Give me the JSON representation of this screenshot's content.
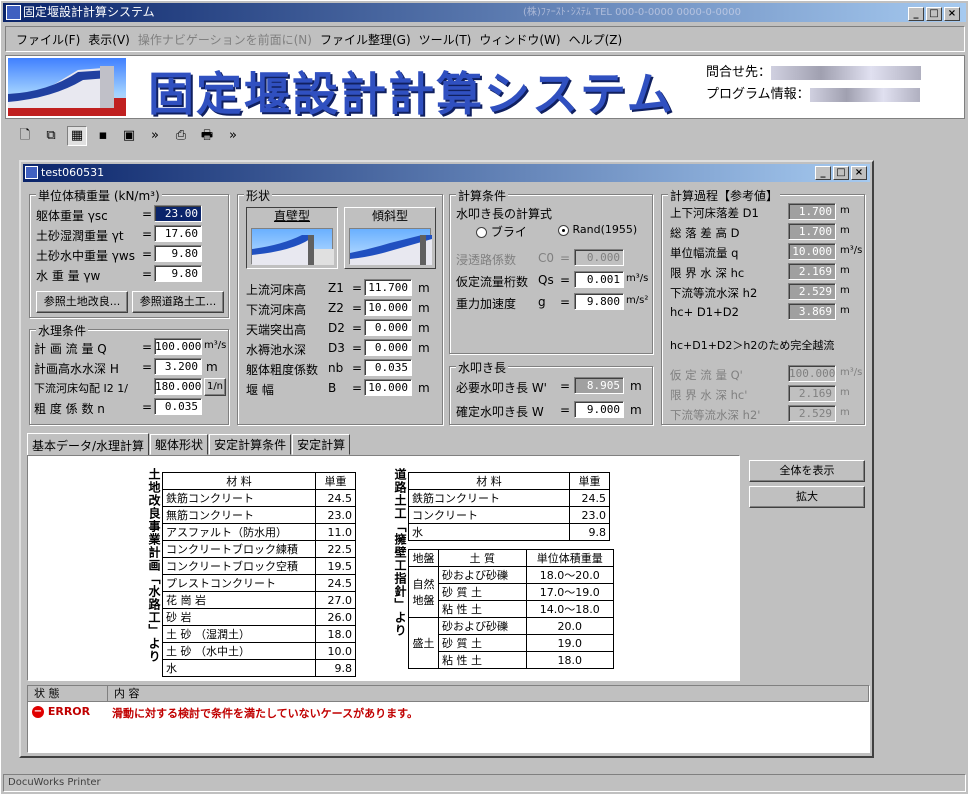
{
  "app": {
    "title": "固定堰設計計算システム",
    "title_extra": "(株)ﾌｧｰｽﾄ･ｼｽﾃﾑ  TEL 000-0-0000  0000-0-0000"
  },
  "menu": [
    "ファイル(F)",
    "表示(V)",
    "操作ナビゲーションを前面に(N)",
    "ファイル整理(G)",
    "ツール(T)",
    "ウィンドウ(W)",
    "ヘルプ(Z)"
  ],
  "banner": {
    "title": "固定堰設計計算システム",
    "contact_label": "問合せ先：",
    "program_label": "プログラム情報："
  },
  "doc": {
    "title": "test060531"
  },
  "unit_weight": {
    "label": "単位体積重量 (kN/m³)",
    "rows": [
      {
        "label": "躯体重量  γsc",
        "value": "23.00"
      },
      {
        "label": "土砂湿潤重量 γt",
        "value": "17.60"
      },
      {
        "label": "土砂水中重量 γws",
        "value": "9.80"
      },
      {
        "label": "水   重   量 γw",
        "value": "9.80"
      }
    ],
    "btn1": "参照土地改良...",
    "btn2": "参照道路土工..."
  },
  "hydro": {
    "label": "水理条件",
    "rows": [
      {
        "label": "計 画 流 量   Q",
        "value": "100.000",
        "unit": "m³/s"
      },
      {
        "label": "計画高水水深  H",
        "value": "3.200",
        "unit": "m"
      },
      {
        "label": "下流河床勾配 I2  1/",
        "value": "180.000",
        "unit": "1/n"
      },
      {
        "label": "粗 度 係 数   n",
        "value": "0.035",
        "unit": ""
      }
    ]
  },
  "shape": {
    "label": "形状",
    "btn_vertical": "直壁型",
    "btn_slope": "傾斜型",
    "rows": [
      {
        "label": "上流河床高",
        "sym": "Z1",
        "value": "11.700",
        "unit": "m"
      },
      {
        "label": "下流河床高",
        "sym": "Z2",
        "value": "10.000",
        "unit": "m"
      },
      {
        "label": "天端突出高",
        "sym": "D2",
        "value": "0.000",
        "unit": "m"
      },
      {
        "label": "水褥池水深",
        "sym": "D3",
        "value": "0.000",
        "unit": "m"
      },
      {
        "label": "躯体粗度係数",
        "sym": "nb",
        "value": "0.035",
        "unit": ""
      },
      {
        "label": "堰     幅",
        "sym": "B",
        "value": "10.000",
        "unit": "m"
      }
    ]
  },
  "calc": {
    "label": "計算条件",
    "formula_label": "水叩き長の計算式",
    "radio1": "ブライ",
    "radio2": "Rand(1955)",
    "rows": [
      {
        "label": "浸透路係数",
        "sym": "C0",
        "value": "0.000",
        "unit": ""
      },
      {
        "label": "仮定流量桁数",
        "sym": "Qs",
        "value": "0.001",
        "unit": "m³/s"
      },
      {
        "label": "重力加速度",
        "sym": "g",
        "value": "9.800",
        "unit": "m/s²"
      }
    ]
  },
  "apron": {
    "label": "水叩き長",
    "rows": [
      {
        "label": "必要水叩き長 W'",
        "value": "8.905",
        "unit": "m"
      },
      {
        "label": "確定水叩き長 W",
        "value": "9.000",
        "unit": "m"
      }
    ]
  },
  "process": {
    "label": "計算過程【参考値】",
    "rows": [
      {
        "label": "上下河床落差 D1",
        "value": "1.700",
        "unit": "m"
      },
      {
        "label": "総 落 差 高  D",
        "value": "1.700",
        "unit": "m"
      },
      {
        "label": "単位幅流量   q",
        "value": "10.000",
        "unit": "m³/s"
      },
      {
        "label": "限 界 水 深  hc",
        "value": "2.169",
        "unit": "m"
      },
      {
        "label": "下流等流水深 h2",
        "value": "2.529",
        "unit": "m"
      },
      {
        "label": "hc+ D1+D2",
        "value": "3.869",
        "unit": "m"
      }
    ],
    "note": "hc+D1+D2＞h2のため完全越流",
    "rows2": [
      {
        "label": "仮 定 流 量  Q'",
        "value": "100.000",
        "unit": "m³/s"
      },
      {
        "label": "限 界 水 深  hc'",
        "value": "2.169",
        "unit": "m"
      },
      {
        "label": "下流等流水深 h2'",
        "value": "2.529",
        "unit": "m"
      }
    ]
  },
  "tabs": [
    "基本データ/水理計算",
    "躯体形状",
    "安定計算条件",
    "安定計算"
  ],
  "side_buttons": [
    "全体を表示",
    "拡大"
  ],
  "table1": {
    "vlabel": "土地改良事業計画「水路工」より",
    "head": [
      "材    料",
      "単重"
    ],
    "rows": [
      [
        "鉄筋コンクリート",
        "24.5"
      ],
      [
        "無筋コンクリート",
        "23.0"
      ],
      [
        "アスファルト（防水用）",
        "11.0"
      ],
      [
        "コンクリートブロック練積",
        "22.5"
      ],
      [
        "コンクリートブロック空積",
        "19.5"
      ],
      [
        "プレストコンクリート",
        "24.5"
      ],
      [
        "花   崗   岩",
        "27.0"
      ],
      [
        "砂       岩",
        "26.0"
      ],
      [
        "土  砂  （湿潤土）",
        "18.0"
      ],
      [
        "土  砂  （水中土）",
        "10.0"
      ],
      [
        "水",
        "9.8"
      ]
    ]
  },
  "table2": {
    "vlabel": "道路土工「擁壁工指針」より",
    "head": [
      "材    料",
      "単重"
    ],
    "rows": [
      [
        "鉄筋コンクリート",
        "24.5"
      ],
      [
        "コンクリート",
        "23.0"
      ],
      [
        "水",
        "9.8"
      ]
    ]
  },
  "table3": {
    "head": [
      "地盤",
      "土    質",
      "単位体積重量"
    ],
    "group1": "自然地盤",
    "group2": "盛土",
    "rows": [
      [
        "砂および砂礫",
        "18.0～20.0"
      ],
      [
        "砂   質   土",
        "17.0～19.0"
      ],
      [
        "粘   性   土",
        "14.0～18.0"
      ],
      [
        "砂および砂礫",
        "20.0"
      ],
      [
        "砂   質   土",
        "19.0"
      ],
      [
        "粘   性   土",
        "18.0"
      ]
    ]
  },
  "log": {
    "col1": "状 態",
    "col2": "内  容",
    "status": "ERROR",
    "message": "滑動に対する検討で条件を満たしていないケースがあります。"
  },
  "statusbar": "DocuWorks Printer"
}
